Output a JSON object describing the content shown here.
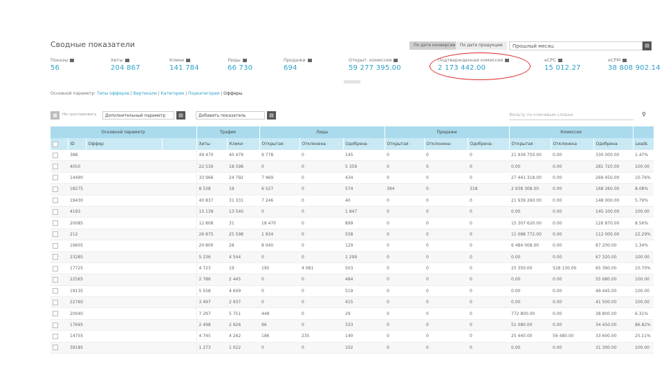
{
  "header": {
    "title": "Сводные показатели",
    "toggle_a": "По дате конверсии",
    "toggle_b": "По дате продукции",
    "period_value": "Прошлый месяц",
    "period_btn": "▤"
  },
  "metrics": [
    {
      "label": "Показы",
      "value": "56"
    },
    {
      "label": "Хиты",
      "value": "204 867"
    },
    {
      "label": "Клики",
      "value": "141 784"
    },
    {
      "label": "Лиды",
      "value": "66 730"
    },
    {
      "label": "Продажи",
      "value": "694"
    },
    {
      "label": "Открыт. комиссия",
      "value": "59 277 395.00"
    },
    {
      "label": "Подтвержденная комиссия",
      "value": "2 173 442.00"
    },
    {
      "label": "eCPC",
      "value": "15 012.27"
    },
    {
      "label": "eCPM",
      "value": "38 808 902.14"
    }
  ],
  "accent": "#2aa0c8",
  "highlight_color": "#dd2222",
  "breadcrumbs": {
    "prefix": "Основной параметр:",
    "items": [
      "Типы офферов",
      "Вертикали",
      "Категории",
      "Подкатегории"
    ],
    "current": "Офферы"
  },
  "toolbar": {
    "square_icon": "▦",
    "group_by": "Не группировать",
    "additional_param": "Дополнительный параметр",
    "add_metric": "Добавить показатель",
    "btn": "▤",
    "filter_placeholder": "Фильтр по ключевым словам",
    "search_icon_glyph": "⚲"
  },
  "table": {
    "groups": [
      {
        "label": "Основной параметр",
        "span": 4
      },
      {
        "label": "Трафик",
        "span": 2
      },
      {
        "label": "Лиды",
        "span": 3
      },
      {
        "label": "Продажи",
        "span": 3
      },
      {
        "label": "Комиссия",
        "span": 3
      },
      {
        "label": "",
        "span": 1
      }
    ],
    "columns": [
      "",
      "ID",
      "Оффер",
      "",
      "Хиты",
      "Клики",
      "Открытая",
      "Отклонена",
      "Одобрена",
      "Открытая",
      "Отклонена",
      "Одобрена",
      "Открытая",
      "Отклонена",
      "Одобрена",
      "Leads"
    ],
    "rows": [
      [
        "388",
        "49 470",
        "40 479",
        "9 778",
        "0",
        "145",
        "0",
        "0",
        "0",
        "21 939 750.00",
        "0.00",
        "330 000.00",
        "1.47%"
      ],
      [
        "4050",
        "22 530",
        "18 598",
        "0",
        "0",
        "5 359",
        "0",
        "0",
        "0",
        "0.00",
        "0.00",
        "281 720.00",
        "100.00"
      ],
      [
        "14490",
        "33 966",
        "24 792",
        "7 969",
        "0",
        "434",
        "0",
        "0",
        "0",
        "27 441 318.00",
        "0.00",
        "269 450.00",
        "10.76%"
      ],
      [
        "18275",
        "8 538",
        "19",
        "6 527",
        "0",
        "574",
        "384",
        "0",
        "318",
        "2 938 308.00",
        "0.00",
        "168 260.00",
        "8.08%"
      ],
      [
        "19430",
        "40 837",
        "31 331",
        "7 246",
        "0",
        "40",
        "0",
        "0",
        "0",
        "21 939 260.00",
        "0.00",
        "148 000.00",
        "5.79%"
      ],
      [
        "4193",
        "15 139",
        "13 540",
        "0",
        "0",
        "1 847",
        "0",
        "0",
        "0",
        "0.00",
        "0.00",
        "145 100.00",
        "100.00"
      ],
      [
        "20085",
        "12 808",
        "31",
        "18 470",
        "0",
        "899",
        "0",
        "0",
        "0",
        "15 307 620.00",
        "0.00",
        "126 870.00",
        "8.56%"
      ],
      [
        "212",
        "26 875",
        "25 598",
        "1 934",
        "0",
        "558",
        "0",
        "0",
        "0",
        "11 088 772.00",
        "0.00",
        "112 000.00",
        "22.29%"
      ],
      [
        "19605",
        "20 800",
        "28",
        "8 040",
        "0",
        "129",
        "0",
        "0",
        "0",
        "6 484 008.00",
        "0.00",
        "87 200.00",
        "1.34%"
      ],
      [
        "23285",
        "5 236",
        "4 544",
        "0",
        "0",
        "1 299",
        "0",
        "0",
        "0",
        "0.00",
        "0.00",
        "67 320.00",
        "100.00"
      ],
      [
        "17725",
        "4 723",
        "19",
        "195",
        "4 081",
        "503",
        "0",
        "0",
        "0",
        "25 350.00",
        "528 130.00",
        "65 390.00",
        "10.70%"
      ],
      [
        "22565",
        "2 786",
        "2 445",
        "0",
        "0",
        "484",
        "0",
        "0",
        "0",
        "0.00",
        "0.00",
        "55 680.00",
        "100.00"
      ],
      [
        "19135",
        "5 558",
        "4 609",
        "0",
        "0",
        "519",
        "0",
        "0",
        "0",
        "0.00",
        "0.00",
        "49 445.00",
        "100.00"
      ],
      [
        "22760",
        "3 497",
        "2 937",
        "0",
        "0",
        "415",
        "0",
        "0",
        "0",
        "0.00",
        "0.00",
        "41 500.00",
        "100.00"
      ],
      [
        "20040",
        "7 297",
        "5 751",
        "449",
        "0",
        "29",
        "0",
        "0",
        "0",
        "772 800.00",
        "0.00",
        "38 800.00",
        "6.31%"
      ],
      [
        "17695",
        "2 498",
        "2 926",
        "96",
        "0",
        "333",
        "0",
        "0",
        "0",
        "51 080.00",
        "0.00",
        "34 450.00",
        "86.82%"
      ],
      [
        "14755",
        "4 745",
        "4 262",
        "186",
        "235",
        "140",
        "0",
        "0",
        "0",
        "25 440.00",
        "56 480.00",
        "33 600.00",
        "25.11%"
      ],
      [
        "39185",
        "1 273",
        "1 022",
        "0",
        "0",
        "102",
        "0",
        "0",
        "0",
        "0.00",
        "0.00",
        "31 300.00",
        "100.00"
      ]
    ]
  }
}
